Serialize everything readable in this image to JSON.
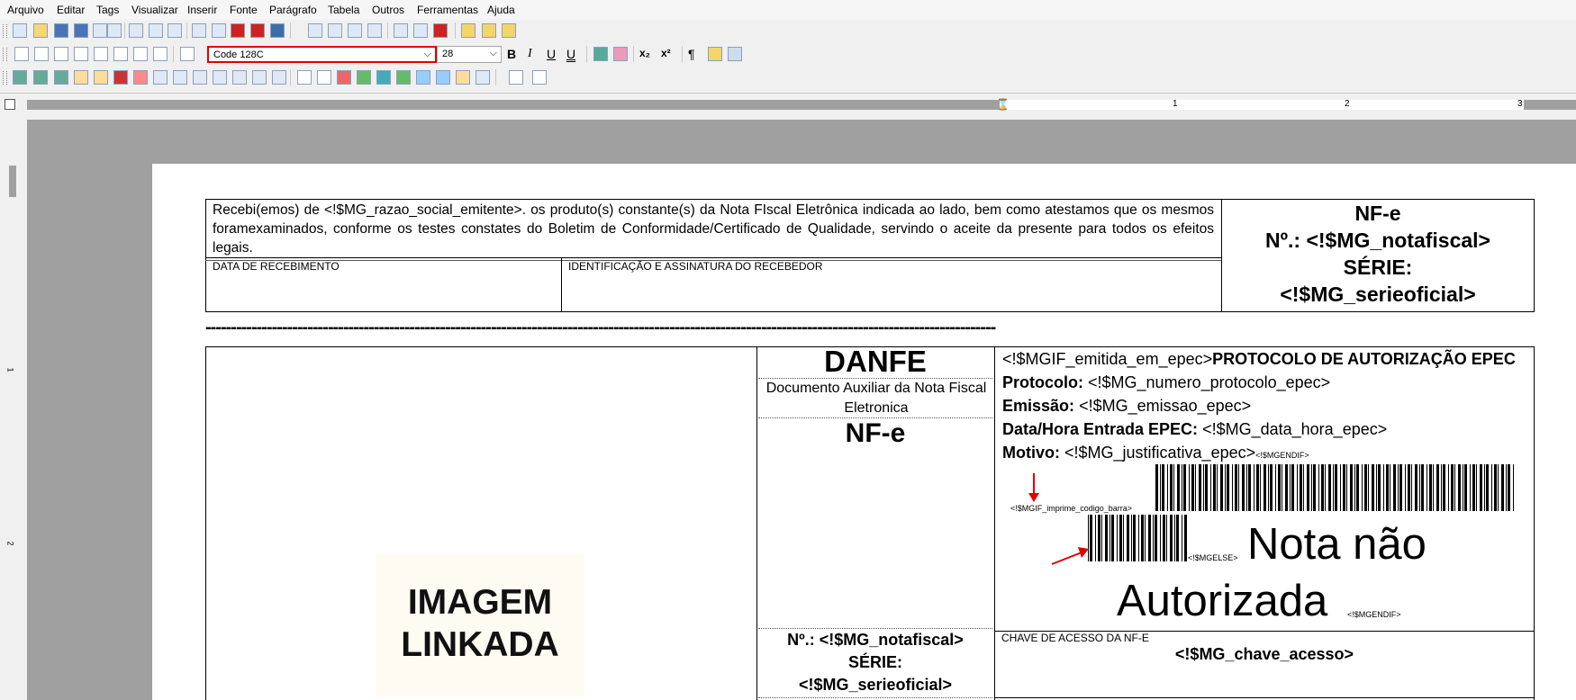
{
  "menu": [
    "Arquivo",
    "Editar",
    "Tags",
    "Visualizar",
    "Inserir",
    "Fonte",
    "Parágrafo",
    "Tabela",
    "Outros",
    "Ferramentas",
    "Ajuda"
  ],
  "format_bar": {
    "font_name": "Code 128C",
    "font_size": "28",
    "bold": "B",
    "italic": "I",
    "underline": "U",
    "double_underline": "U",
    "subscript": "x₂",
    "superscript": "x²",
    "pilcrow": "¶"
  },
  "ruler": {
    "marks": [
      "1",
      "2",
      "3"
    ]
  },
  "receipt": {
    "text": "Recebi(emos) de <!$MG_razao_social_emitente>. os produto(s) constante(s) da Nota FIscal Eletrônica indicada ao lado, bem como atestamos que os mesmos foramexaminados, conforme os testes constates do Boletim de Conformidade/Certificado de Qualidade, servindo o aceite da presente para todos os efeitos legais.",
    "date_label": "DATA DE RECEBIMENTO",
    "signature_label": "IDENTIFICAÇÃO E ASSINATURA DO RECEBEDOR",
    "nfe_title": "NF-e",
    "nfe_number": "Nº.: <!$MG_notafiscal>",
    "nfe_serie": "SÉRIE:",
    "nfe_serie_value": "<!$MG_serieoficial>"
  },
  "separator": "-----------------------------------------------------------------------------------------------------------------------------------------------------------",
  "danfe": {
    "image_placeholder_line1": "IMAGEM",
    "image_placeholder_line2": "LINKADA",
    "title": "DANFE",
    "subtitle": "Documento Auxiliar da Nota Fiscal Eletronica",
    "nfe": "NF-e",
    "number": "Nº.: <!$MG_notafiscal>",
    "serie": "SÉRIE:",
    "serie_value": "<!$MG_serieoficial>"
  },
  "epec": {
    "header_tag": "<!$MGIF_emitida_em_epec>",
    "header_title": "PROTOCOLO DE AUTORIZAÇÃO EPEC",
    "protocolo_label": "Protocolo:",
    "protocolo_value": "<!$MG_numero_protocolo_epec>",
    "emissao_label": "Emissão:",
    "emissao_value": "<!$MG_emissao_epec>",
    "data_hora_label": "Data/Hora Entrada EPEC:",
    "data_hora_value": "<!$MG_data_hora_epec>",
    "motivo_label": "Motivo:",
    "motivo_value": "<!$MG_justificativa_epec>",
    "endif_tag": "<!$MGENDIF>",
    "imprime_tag": "<!$MGIF_imprime_codigo_barra>",
    "else_tag": "<!$MGELSE>",
    "nota_nao": "Nota não",
    "autorizada": "Autorizada",
    "endif_tag2": "<!$MGENDIF>"
  },
  "chave": {
    "label": "CHAVE DE ACESSO DA NF-E",
    "value": "<!$MG_chave_acesso>"
  },
  "colors": {
    "highlight": "#e00000",
    "canvas": "#a0a0a0"
  }
}
